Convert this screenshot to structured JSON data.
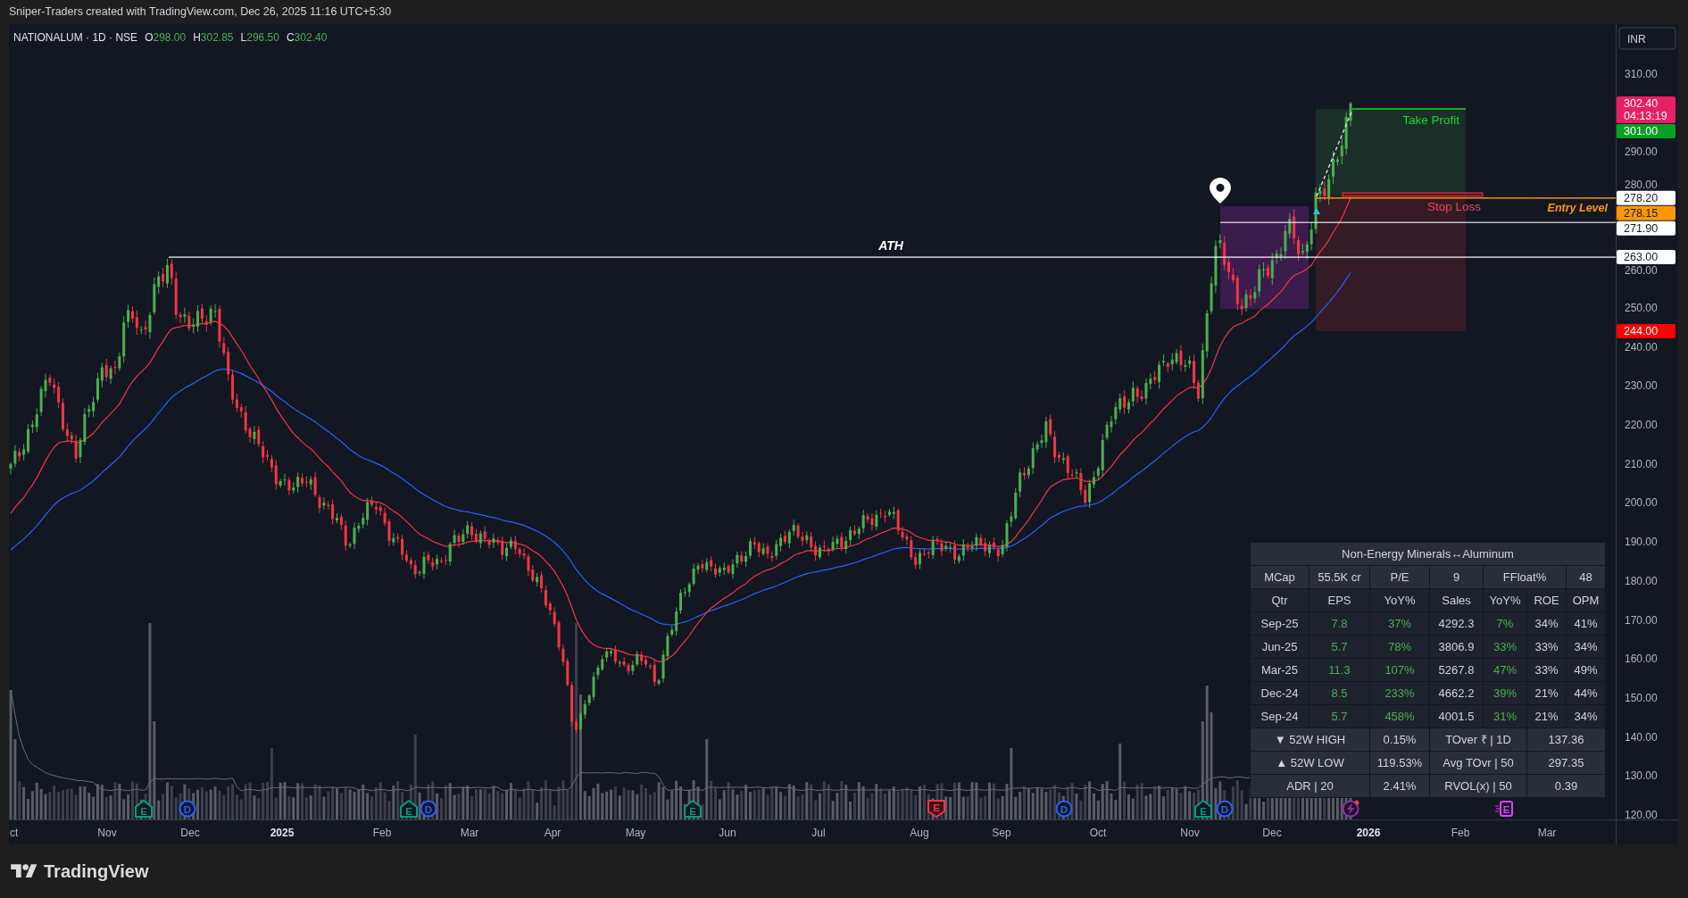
{
  "header": {
    "attribution": "Sniper-Traders created with TradingView.com, Dec 26, 2025 11:16 UTC+5:30"
  },
  "legend": {
    "symbol": "NATIONALUM · 1D · NSE",
    "ohlc": [
      {
        "label": "O",
        "value": "298.00"
      },
      {
        "label": "H",
        "value": "302.85"
      },
      {
        "label": "L",
        "value": "296.50"
      },
      {
        "label": "C",
        "value": "302.40"
      }
    ]
  },
  "drawings": {
    "ath_label": "ATH",
    "take_profit_label": "Take Profit",
    "stop_loss_label": "Stop Loss",
    "entry_label": "Entry Level"
  },
  "events": [
    {
      "kind": "earnings_up",
      "label": "E",
      "color": "#089981"
    },
    {
      "kind": "dividend",
      "label": "D",
      "color": "#2962ff"
    },
    {
      "kind": "earnings_up",
      "label": "E",
      "color": "#089981"
    },
    {
      "kind": "dividend",
      "label": "D",
      "color": "#2962ff"
    },
    {
      "kind": "earnings_up",
      "label": "E",
      "color": "#089981"
    },
    {
      "kind": "earnings_down",
      "label": "E",
      "color": "#f23645"
    },
    {
      "kind": "dividend",
      "label": "D",
      "color": "#2962ff"
    },
    {
      "kind": "earnings_up",
      "label": "E",
      "color": "#089981"
    },
    {
      "kind": "dividend",
      "label": "D",
      "color": "#2962ff"
    },
    {
      "kind": "alert",
      "color": "#9c27b0"
    },
    {
      "kind": "earnings_upcoming",
      "label": "E",
      "color": "#e040fb"
    }
  ],
  "fundamentals_table": {
    "title": "Non-Energy Minerals↔Aluminum",
    "summary": [
      {
        "label": "MCap",
        "value": "55.5K cr"
      },
      {
        "label": "P/E",
        "value": "9"
      },
      {
        "label": "FFloat%",
        "value": "48"
      }
    ],
    "columns": [
      {
        "label": "Qtr",
        "highlight": false
      },
      {
        "label": "EPS",
        "highlight": true
      },
      {
        "label": "YoY%",
        "highlight": true
      },
      {
        "label": "Sales",
        "highlight": false
      },
      {
        "label": "YoY%",
        "highlight": true
      },
      {
        "label": "ROE",
        "highlight": false
      },
      {
        "label": "OPM",
        "highlight": false
      }
    ],
    "rows": [
      {
        "cells": [
          "Sep-25",
          "7.8",
          "37%",
          "4292.3",
          "7%",
          "34%",
          "41%"
        ]
      },
      {
        "cells": [
          "Jun-25",
          "5.7",
          "78%",
          "3806.9",
          "33%",
          "33%",
          "34%"
        ]
      },
      {
        "cells": [
          "Mar-25",
          "11.3",
          "107%",
          "5267.8",
          "47%",
          "33%",
          "49%"
        ]
      },
      {
        "cells": [
          "Dec-24",
          "8.5",
          "233%",
          "4662.2",
          "39%",
          "21%",
          "44%"
        ]
      },
      {
        "cells": [
          "Sep-24",
          "5.7",
          "458%",
          "4001.5",
          "31%",
          "21%",
          "34%"
        ]
      }
    ],
    "stats": [
      {
        "pairs": [
          {
            "label": "▼ 52W HIGH",
            "value": "0.15%"
          },
          {
            "label": "TOver ₹ | 1D",
            "value": "137.36"
          }
        ]
      },
      {
        "pairs": [
          {
            "label": "▲ 52W LOW",
            "value": "119.53%"
          },
          {
            "label": "Avg TOvr | 50",
            "value": "297.35"
          }
        ]
      },
      {
        "pairs": [
          {
            "label": "ADR | 20",
            "value": "2.41%"
          },
          {
            "label": "RVOL(x) | 50",
            "value": "0.39"
          }
        ]
      }
    ]
  },
  "price_axis": {
    "currency": "INR",
    "ticks": [
      "310.00",
      "290.00",
      "280.00",
      "260.00",
      "250.00",
      "240.00",
      "230.00",
      "220.00",
      "210.00",
      "200.00",
      "190.00",
      "180.00",
      "170.00",
      "160.00",
      "150.00",
      "140.00",
      "130.00",
      "120.00"
    ],
    "tags": [
      {
        "value": "302.40",
        "countdown": "04:13:19",
        "color": "#e91e63"
      },
      {
        "value": "301.00",
        "color": "#089f22"
      },
      {
        "value": "278.20",
        "color": "#ffffff"
      },
      {
        "value": "278.15",
        "color": "#ff9800"
      },
      {
        "value": "271.90",
        "color": "#ffffff"
      },
      {
        "value": "263.00",
        "color": "#ffffff"
      },
      {
        "value": "244.00",
        "color": "#ff0000"
      }
    ]
  },
  "time_axis": {
    "labels": [
      {
        "label": "ct",
        "kind": "month"
      },
      {
        "label": "Nov",
        "kind": "month"
      },
      {
        "label": "Dec",
        "kind": "month"
      },
      {
        "label": "2025",
        "kind": "year"
      },
      {
        "label": "Feb",
        "kind": "month"
      },
      {
        "label": "Mar",
        "kind": "month"
      },
      {
        "label": "Apr",
        "kind": "month"
      },
      {
        "label": "May",
        "kind": "month"
      },
      {
        "label": "Jun",
        "kind": "month"
      },
      {
        "label": "Jul",
        "kind": "month"
      },
      {
        "label": "Aug",
        "kind": "month"
      },
      {
        "label": "Sep",
        "kind": "month"
      },
      {
        "label": "Oct",
        "kind": "month"
      },
      {
        "label": "Nov",
        "kind": "month"
      },
      {
        "label": "Dec",
        "kind": "month"
      },
      {
        "label": "2026",
        "kind": "year"
      },
      {
        "label": "Feb",
        "kind": "month"
      },
      {
        "label": "Mar",
        "kind": "month"
      }
    ]
  },
  "footer": {
    "brand": "TradingView"
  }
}
